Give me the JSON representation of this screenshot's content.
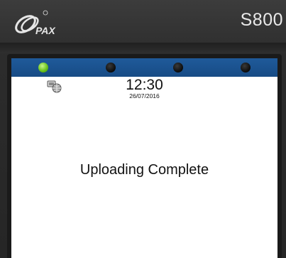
{
  "device": {
    "brand": "PAX",
    "model": "S800"
  },
  "leds": [
    {
      "state": "on",
      "color": "#6cc41e"
    },
    {
      "state": "off",
      "color": "#111111"
    },
    {
      "state": "off",
      "color": "#111111"
    },
    {
      "state": "off",
      "color": "#111111"
    }
  ],
  "status_bar": {
    "icon": "network-globe-icon",
    "time": "12:30",
    "date": "26/07/2016"
  },
  "screen": {
    "message": "Uploading Complete"
  },
  "colors": {
    "led_bar": "#1f5a9a",
    "screen_bg": "#ffffff",
    "casing": "#2c2c2c"
  }
}
